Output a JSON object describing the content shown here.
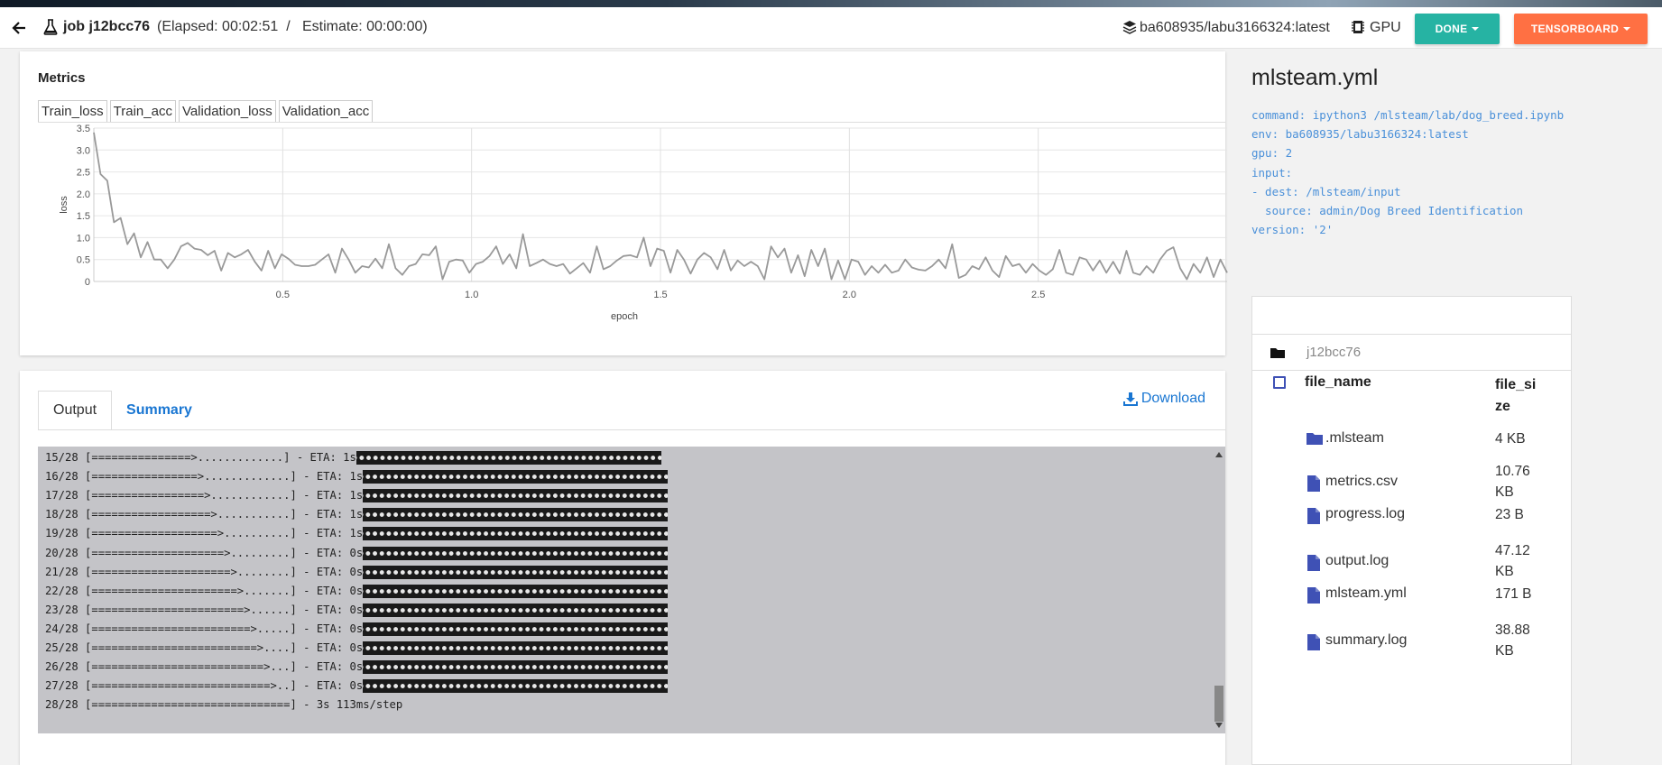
{
  "header": {
    "job_title": "job j12bcc76",
    "elapsed": "(Elapsed: 00:02:51  /   Estimate: 00:00:00)",
    "env": "ba608935/labu3166324:latest",
    "gpu": "GPU",
    "done_label": "DONE",
    "tensorboard_label": "TENSORBOARD"
  },
  "metrics": {
    "title": "Metrics",
    "tabs": [
      "Train_loss",
      "Train_acc",
      "Validation_loss",
      "Validation_acc"
    ]
  },
  "chart_data": {
    "type": "line",
    "xlabel": "epoch",
    "ylabel": "loss",
    "xlim": [
      0,
      3
    ],
    "ylim": [
      0,
      3.5
    ],
    "xticks": [
      "0.5",
      "1.0",
      "1.5",
      "2.0",
      "2.5"
    ],
    "yticks": [
      "0",
      "0.5",
      "1.0",
      "1.5",
      "2.0",
      "2.5",
      "3.0",
      "3.5"
    ],
    "grid": true,
    "series": [
      {
        "color": "#999999",
        "values": [
          3.4,
          2.45,
          2.3,
          1.35,
          1.45,
          0.85,
          1.1,
          0.55,
          0.9,
          0.5,
          0.5,
          0.3,
          0.5,
          0.8,
          0.88,
          0.75,
          0.72,
          0.6,
          0.7,
          0.25,
          0.65,
          0.55,
          0.62,
          0.72,
          0.45,
          0.25,
          0.7,
          0.3,
          0.62,
          0.52,
          0.38,
          0.35,
          0.35,
          0.38,
          0.5,
          0.62,
          0.2,
          0.75,
          0.5,
          0.2,
          0.35,
          0.32,
          0.52,
          0.3,
          0.85,
          0.3,
          0.15,
          0.35,
          0.4,
          0.62,
          0.6,
          0.8,
          0.05,
          0.45,
          0.5,
          0.48,
          0.2,
          0.4,
          0.45,
          0.58,
          0.8,
          0.4,
          0.62,
          0.3,
          1.08,
          0.35,
          0.42,
          0.5,
          0.4,
          0.35,
          0.4,
          0.18,
          0.3,
          0.42,
          0.2,
          0.8,
          0.28,
          0.35,
          0.48,
          0.58,
          0.6,
          0.55,
          1.0,
          0.35,
          0.75,
          0.7,
          0.2,
          0.72,
          0.5,
          0.18,
          0.5,
          0.65,
          0.55,
          0.28,
          0.72,
          0.25,
          0.48,
          0.35,
          0.45,
          0.35,
          0.05,
          0.8,
          0.55,
          0.75,
          0.2,
          0.6,
          0.12,
          0.72,
          0.35,
          0.75,
          0.05,
          0.48,
          0.05,
          0.5,
          0.45,
          0.15,
          0.35,
          0.2,
          0.38,
          0.2,
          0.25,
          0.5,
          0.32,
          0.27,
          0.25,
          0.35,
          0.5,
          0.3,
          0.85,
          0.08,
          0.15,
          0.35,
          0.28,
          0.55,
          0.25,
          0.1,
          0.58,
          0.35,
          0.4,
          0.2,
          0.4,
          0.25,
          0.15,
          0.28,
          0.72,
          0.2,
          0.15,
          0.55,
          0.5,
          0.25,
          0.48,
          0.2,
          0.45,
          0.18,
          0.7,
          0.2,
          0.15,
          0.35,
          0.2,
          0.5,
          0.7,
          0.78,
          0.3,
          0.05,
          0.4,
          0.2,
          0.55,
          0.1,
          0.5,
          0.2
        ]
      }
    ]
  },
  "output": {
    "tabs": [
      "Output",
      "Summary"
    ],
    "download_label": "Download",
    "lines": [
      {
        "text": "15/28 [===============>.............] - ETA: 1s",
        "block": true
      },
      {
        "text": "16/28 [================>.............] - ETA: 1s",
        "block": true
      },
      {
        "text": "17/28 [=================>............] - ETA: 1s",
        "block": true
      },
      {
        "text": "18/28 [==================>...........] - ETA: 1s",
        "block": true
      },
      {
        "text": "19/28 [===================>..........] - ETA: 1s",
        "block": true
      },
      {
        "text": "20/28 [====================>.........] - ETA: 0s",
        "block": true
      },
      {
        "text": "21/28 [=====================>........] - ETA: 0s",
        "block": true
      },
      {
        "text": "22/28 [======================>.......] - ETA: 0s",
        "block": true
      },
      {
        "text": "23/28 [=======================>......] - ETA: 0s",
        "block": true
      },
      {
        "text": "24/28 [========================>.....] - ETA: 0s",
        "block": true
      },
      {
        "text": "25/28 [=========================>....] - ETA: 0s",
        "block": true
      },
      {
        "text": "26/28 [==========================>...] - ETA: 0s",
        "block": true
      },
      {
        "text": "27/28 [===========================>..] - ETA: 0s",
        "block": true
      },
      {
        "text": "28/28 [==============================] - 3s 113ms/step",
        "block": false
      }
    ]
  },
  "yml": {
    "title": "mlsteam.yml",
    "content": "command: ipython3 /mlsteam/lab/dog_breed.ipynb\nenv: ba608935/labu3166324:latest\ngpu: 2\ninput:\n- dest: /mlsteam/input\n  source: admin/Dog Breed Identification\nversion: '2'"
  },
  "files": {
    "crumb": "j12bcc76",
    "col_name": "file_name",
    "col_size": "file_size",
    "rows": [
      {
        "name": ".mlsteam",
        "size": "4 KB",
        "icon": "folder-icon"
      },
      {
        "name": "metrics.csv",
        "size": "10.76 KB",
        "icon": "file-icon"
      },
      {
        "name": "progress.log",
        "size": "23 B",
        "icon": "file-icon"
      },
      {
        "name": "output.log",
        "size": "47.12 KB",
        "icon": "file-icon"
      },
      {
        "name": "mlsteam.yml",
        "size": "171 B",
        "icon": "file-icon"
      },
      {
        "name": "summary.log",
        "size": "38.88 KB",
        "icon": "file-icon"
      }
    ]
  }
}
